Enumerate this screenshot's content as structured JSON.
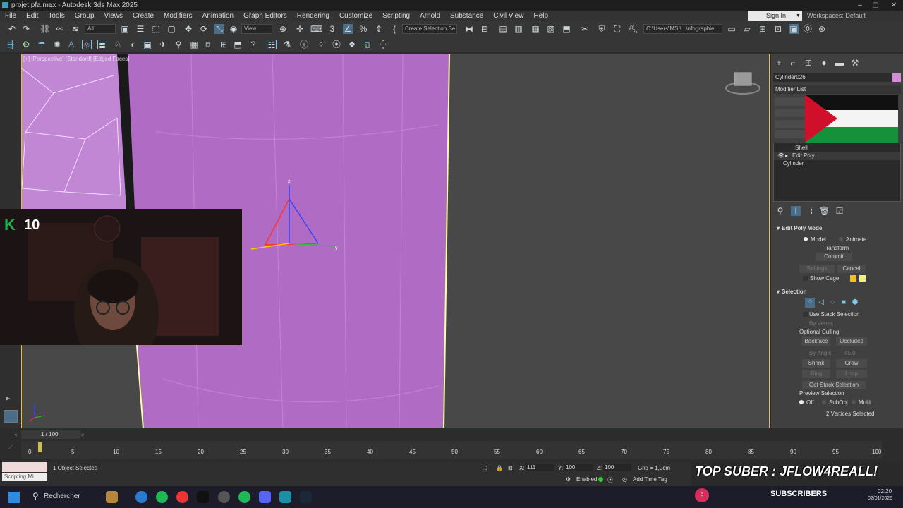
{
  "window": {
    "title": "projet pfa.max - Autodesk 3ds Max 2025"
  },
  "menu": [
    "File",
    "Edit",
    "Tools",
    "Group",
    "Views",
    "Create",
    "Modifiers",
    "Animation",
    "Graph Editors",
    "Rendering",
    "Customize",
    "Scripting",
    "Arnold",
    "Substance",
    "Civil View",
    "Help"
  ],
  "account": {
    "signin": "Sign In",
    "workspaces": "Workspaces: Default"
  },
  "toolbar": {
    "filter": "All",
    "ref_coord": "View",
    "selection_set": "Create Selection Se",
    "project_path": "C:\\Users\\MSI\\...\\nfographie"
  },
  "viewport": {
    "label": "[+] [Perspective] [Standard] [Edged Faces]"
  },
  "overlay": {
    "k_count": "10"
  },
  "panel": {
    "object_name": "Cylinder026",
    "modifier_list": "Modifier List",
    "stack": [
      {
        "label": "Shell"
      },
      {
        "label": "Edit Poly"
      },
      {
        "label": "Cylinder"
      }
    ],
    "edit_poly_mode": {
      "title": "Edit Poly Mode",
      "model": "Model",
      "animate": "Animate",
      "transform": "Transform",
      "commit": "Commit",
      "settings": "Settings",
      "cancel": "Cancel",
      "show_cage": "Show Cage"
    },
    "selection": {
      "title": "Selection",
      "use_stack": "Use Stack Selection",
      "by_vertex": "By Vertex",
      "optional_culling": "Optional Culling",
      "backface": "Backface",
      "occluded": "Occluded",
      "by_angle": "By Angle:",
      "angle_value": "45.0",
      "shrink": "Shrink",
      "grow": "Grow",
      "ring": "Ring",
      "loop": "Loop",
      "get_stack": "Get Stack Selection",
      "preview": "Preview Selection",
      "off": "Off",
      "subobj": "SubObj",
      "multi": "Multi",
      "status": "2 Vertices Selected"
    }
  },
  "timeline": {
    "frame": "1 / 100",
    "ticks": [
      "0",
      "5",
      "10",
      "15",
      "20",
      "25",
      "30",
      "35",
      "40",
      "45",
      "50",
      "55",
      "60",
      "65",
      "70",
      "75",
      "80",
      "85",
      "90",
      "95",
      "100"
    ]
  },
  "status": {
    "script_label": "Scripting Mi",
    "selected": "1 Object Selected",
    "x_label": "X:",
    "x": "111",
    "y_label": "Y:",
    "y": "100",
    "z_label": "Z:",
    "z": "100",
    "grid": "Grid = 1,0cm",
    "enabled": "Enabled:",
    "time_tag": "Add Time Tag",
    "banner": "TOP SUBER : JFLOW4REALL!"
  },
  "taskbar": {
    "search": "Rechercher",
    "sub_count": "9",
    "subscribers": "SUBSCRIBERS",
    "time": "02:20",
    "date": "02/01/2026"
  },
  "colors": {
    "accent": "#3aa0b8",
    "object": "#b06cc4",
    "selection": "#e0c050",
    "brand": "#19b34a"
  }
}
